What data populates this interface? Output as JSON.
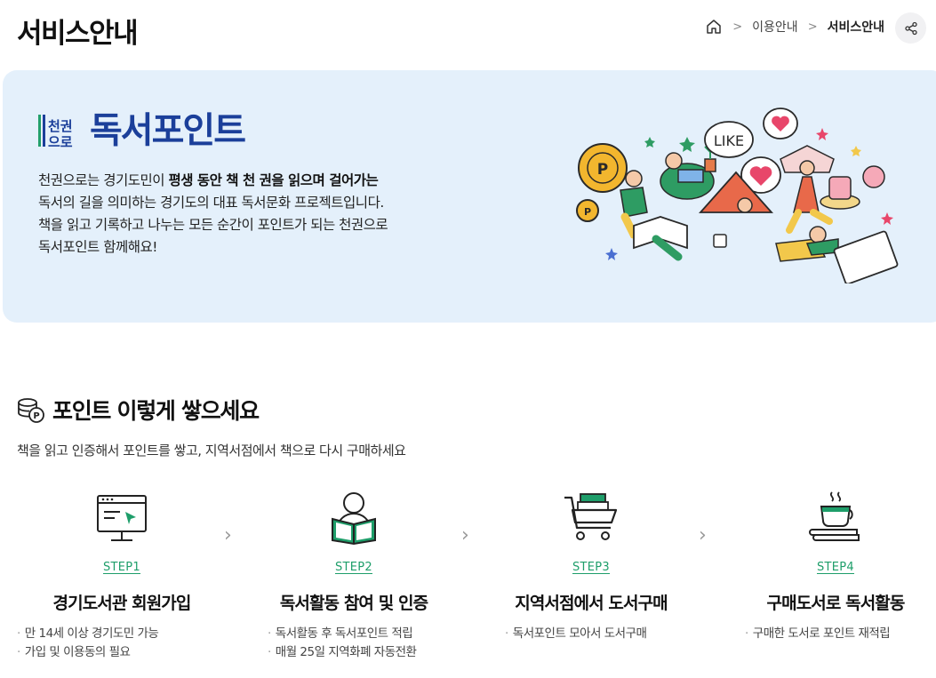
{
  "header": {
    "title": "서비스안내",
    "breadcrumb": [
      {
        "label": "이용안내"
      },
      {
        "label": "서비스안내"
      }
    ]
  },
  "banner": {
    "logo_mark_top": "천권",
    "logo_mark_bottom": "으로",
    "logo_text": "독서포인트",
    "desc_line1_plain": "천권으로는 경기도민이 ",
    "desc_line1_bold": "평생 동안 책 천 권을 읽으며 걸어가는",
    "desc_line2": "독서의 길을 의미하는 경기도의 대표 독서문화 프로젝트입니다.",
    "desc_line3": "책을 읽고 기록하고 나누는 모든 순간이 포인트가 되는 천권으로",
    "desc_line4": "독서포인트 함께해요!",
    "illustration_like": "LIKE",
    "illustration_coin": "P"
  },
  "section": {
    "title": "포인트 이렇게 쌓으세요",
    "subtitle": "책을 읽고 인증해서 포인트를 쌓고, 지역서점에서 책으로 다시 구매하세요"
  },
  "steps": [
    {
      "label": "STEP1",
      "name": "경기도서관 회원가입",
      "icon": "computer-icon",
      "items": [
        "만 14세 이상 경기도민 가능",
        "가입 및 이용동의 필요"
      ]
    },
    {
      "label": "STEP2",
      "name": "독서활동 참여 및 인증",
      "icon": "reading-person-icon",
      "items": [
        "독서활동 후 독서포인트 적립",
        "매월 25일 지역화폐 자동전환"
      ]
    },
    {
      "label": "STEP3",
      "name": "지역서점에서 도서구매",
      "icon": "shopping-cart-icon",
      "items": [
        "독서포인트 모아서 도서구매"
      ]
    },
    {
      "label": "STEP4",
      "name": "구매도서로 독서활동",
      "icon": "coffee-books-icon",
      "items": [
        "구매한 도서로 포인트 재적립"
      ]
    }
  ],
  "colors": {
    "accent": "#1e9e6a",
    "brand": "#1b3f9a",
    "banner_bg": "#e4f0fb"
  }
}
